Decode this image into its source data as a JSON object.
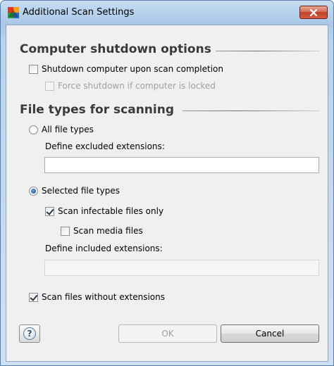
{
  "window": {
    "title": "Additional Scan Settings"
  },
  "shutdown_section": {
    "heading": "Computer shutdown options",
    "shutdown_on_completion": {
      "label": "Shutdown computer upon scan completion",
      "checked": false
    },
    "force_shutdown": {
      "label": "Force shutdown if computer is locked",
      "checked": false,
      "disabled": true
    }
  },
  "file_types_section": {
    "heading": "File types for scanning",
    "all_file_types": {
      "label": "All file types",
      "selected": false
    },
    "excluded_extensions": {
      "label": "Define excluded extensions:",
      "value": ""
    },
    "selected_file_types": {
      "label": "Selected file types",
      "selected": true
    },
    "scan_infectable_only": {
      "label": "Scan infectable files only",
      "checked": true
    },
    "scan_media_files": {
      "label": "Scan media files",
      "checked": false
    },
    "included_extensions": {
      "label": "Define included extensions:",
      "value": ""
    },
    "scan_without_extensions": {
      "label": "Scan files without extensions",
      "checked": true
    }
  },
  "buttons": {
    "help": "?",
    "ok": "OK",
    "cancel": "Cancel"
  },
  "icons": {
    "app": "avg-logo-icon",
    "close": "close-icon",
    "help": "help-icon"
  },
  "colors": {
    "title_bar": "#b5d0ec",
    "close_button": "#c2412a",
    "client_bg": "#f0f0f0",
    "disabled_text": "#a0a0a0"
  }
}
